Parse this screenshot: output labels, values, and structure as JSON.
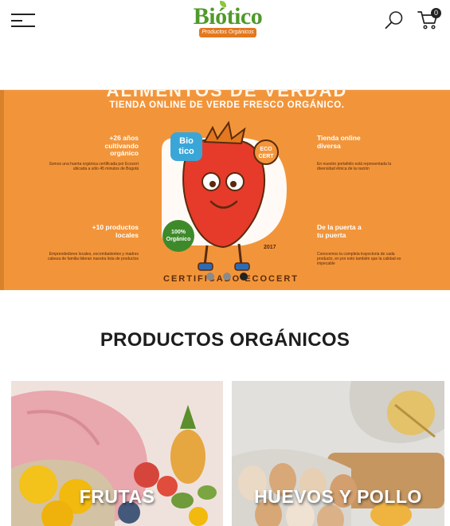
{
  "header": {
    "logo": {
      "name": "Biótico",
      "tagline": "Productos Orgánicos"
    },
    "cart_count": "0",
    "icons": {
      "menu": "hamburger-menu-icon",
      "search": "search-icon",
      "cart": "cart-icon"
    }
  },
  "banner": {
    "heading": "ALIMENTOS DE VERDAD",
    "subheading": "TIENDA ONLINE DE VERDE FRESCO ORGÁNICO.",
    "stat1": {
      "title": "+26 años cultivando orgánico",
      "text": "Somos una huerta orgánica certificada por Ecocert ubicada a sólo 45 minutos de Bogotá"
    },
    "stat2": {
      "title": "+10 productos locales",
      "text": "Emprendedores locales, excombatientes y madres cabeza de familia lideran nuestra lista de productos"
    },
    "stat3": {
      "title": "Tienda online diversa",
      "text": "En nuestro portafolio está representada la diversidad étnica de la nación"
    },
    "stat4": {
      "title": "De la puerta a tu puerta",
      "text": "Conocemos la completa trayectoria de cada producto, en por esto también que la calidad es impecable"
    },
    "badge_bio": "Bio tico",
    "badge_eco": "ECO CERT",
    "badge_organic": "100% Orgánico",
    "year": "2017",
    "bottom_text": "CERTIFICADO ECOCERT",
    "slides": 3,
    "active_slide": 3,
    "colors": {
      "background": "#f2953a",
      "dark": "#5a2a0c"
    }
  },
  "section": {
    "title": "PRODUCTOS ORGÁNICOS"
  },
  "categories": [
    {
      "label": "FRUTAS"
    },
    {
      "label": "HUEVOS Y POLLO"
    }
  ]
}
